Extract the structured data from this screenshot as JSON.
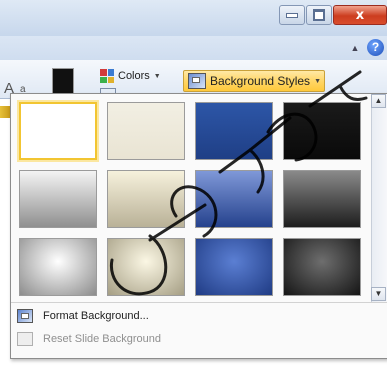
{
  "window": {
    "minimize_glyph": "",
    "close_glyph": "x"
  },
  "topbar": {
    "help_label": "?"
  },
  "ribbon": {
    "font_preview": "A",
    "font_preview_small": "a",
    "colors_label": "Colors",
    "background_styles_label": "Background Styles",
    "accent_color": "#ffd667"
  },
  "gallery": {
    "thumbnails": [
      {
        "style": "white",
        "colors": [
          "#ffffff",
          "#ffffff"
        ],
        "selected": true
      },
      {
        "style": "cream",
        "colors": [
          "#f2efe3",
          "#e9e4d3"
        ],
        "selected": false
      },
      {
        "style": "blue",
        "colors": [
          "#2d56a7",
          "#1f3f86"
        ],
        "selected": false
      },
      {
        "style": "black",
        "colors": [
          "#1a1a1a",
          "#0a0a0a"
        ],
        "selected": false
      },
      {
        "style": "gray-gradient",
        "colors": [
          "#f4f4f4",
          "#8f8f8f"
        ],
        "selected": false
      },
      {
        "style": "cream-gradient",
        "colors": [
          "#f6f1dc",
          "#b9b197"
        ],
        "selected": false
      },
      {
        "style": "blue-gradient",
        "colors": [
          "#7f98d8",
          "#25428d"
        ],
        "selected": false
      },
      {
        "style": "dark-gradient",
        "colors": [
          "#8a8a8a",
          "#1d1d1d"
        ],
        "selected": false
      },
      {
        "style": "gray-radial",
        "colors": [
          "#ffffff",
          "#8c8c8c"
        ],
        "selected": false
      },
      {
        "style": "cream-radial",
        "colors": [
          "#fbf7e4",
          "#a59e84"
        ],
        "selected": false
      },
      {
        "style": "blue-radial",
        "colors": [
          "#5b7fd3",
          "#1f3b84"
        ],
        "selected": false
      },
      {
        "style": "dark-radial",
        "colors": [
          "#6e6e6e",
          "#151515"
        ],
        "selected": false
      }
    ]
  },
  "menu": {
    "format_background": "Format Background...",
    "reset_slide_background": "Reset Slide Background"
  },
  "icons": {
    "help": "help-icon",
    "collapse": "caret-up-icon",
    "background_styles": "background-styles-icon",
    "format_background": "format-background-icon",
    "reset_background": "reset-background-icon",
    "scroll_down": "chevron-down-icon"
  }
}
